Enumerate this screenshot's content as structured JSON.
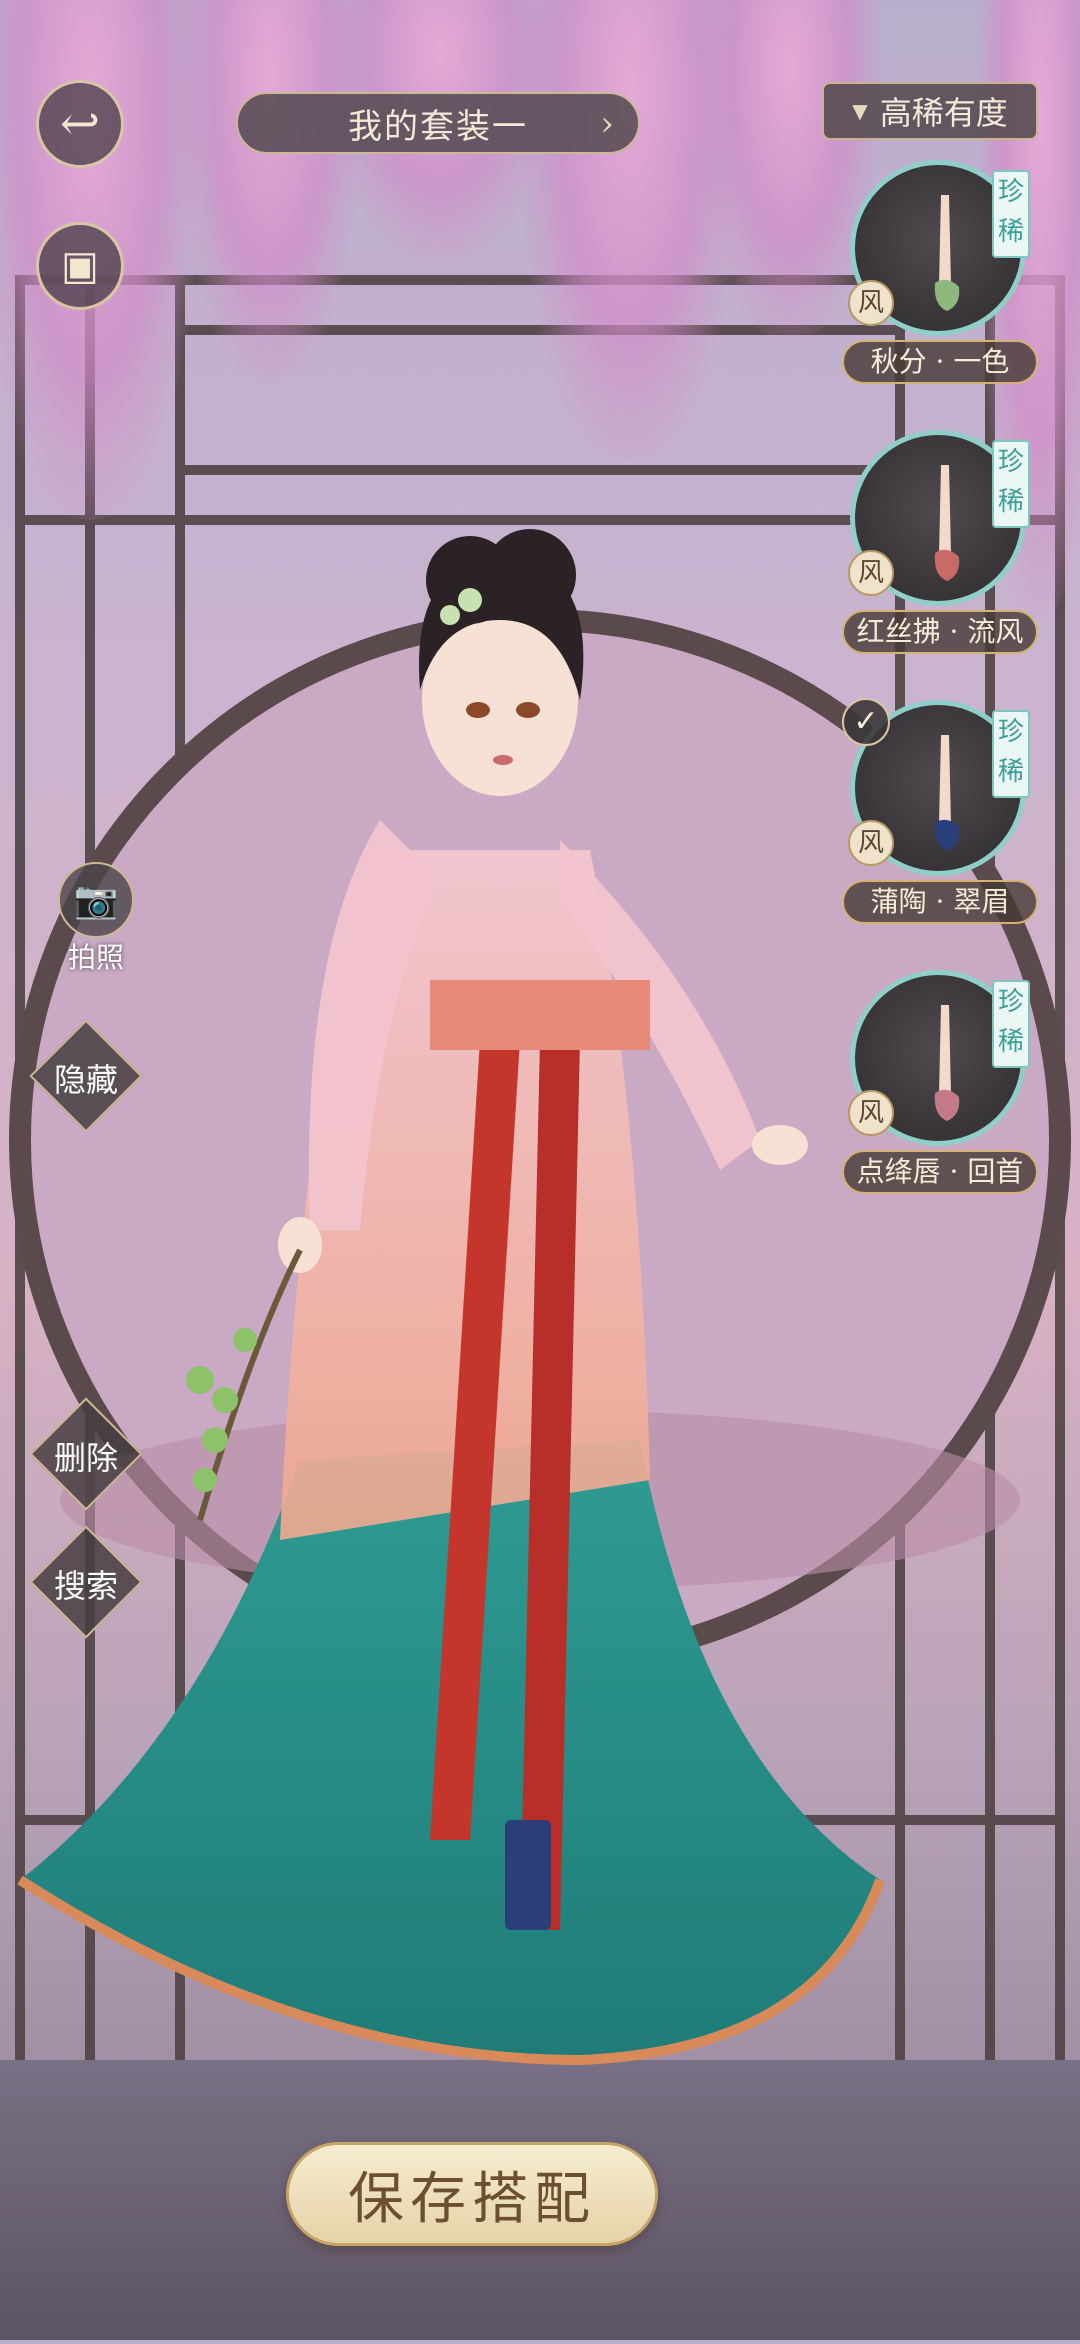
{
  "header": {
    "outfit_title": "我的套装一",
    "sort_label": "高稀有度"
  },
  "items": [
    {
      "rarity": "珍稀",
      "style": "风",
      "name": "秋分 · 一色",
      "selected": false,
      "shoe_color": "#8fb87f"
    },
    {
      "rarity": "珍稀",
      "style": "风",
      "name": "红丝拂 · 流风",
      "selected": false,
      "shoe_color": "#c86a66"
    },
    {
      "rarity": "珍稀",
      "style": "风",
      "name": "蒲陶 · 翠眉",
      "selected": true,
      "shoe_color": "#2a3e7a"
    },
    {
      "rarity": "珍稀",
      "style": "风",
      "name": "点绛唇 · 回首",
      "selected": false,
      "shoe_color": "#c57a8a"
    }
  ],
  "side_actions": {
    "photo": "拍照",
    "hide": "隐藏",
    "delete": "删除",
    "search": "搜索"
  },
  "save_button": "保存搭配",
  "icons": {
    "back": "back-arrow-icon",
    "wardrobe": "wardrobe-icon",
    "camera": "camera-icon",
    "chevron": "chevron-right-icon",
    "check": "check-icon",
    "sort": "triangle-down-icon"
  },
  "colors": {
    "badge_teal": "#3a9e98",
    "gold": "#d4b271",
    "button_dark": "#4e464a"
  }
}
